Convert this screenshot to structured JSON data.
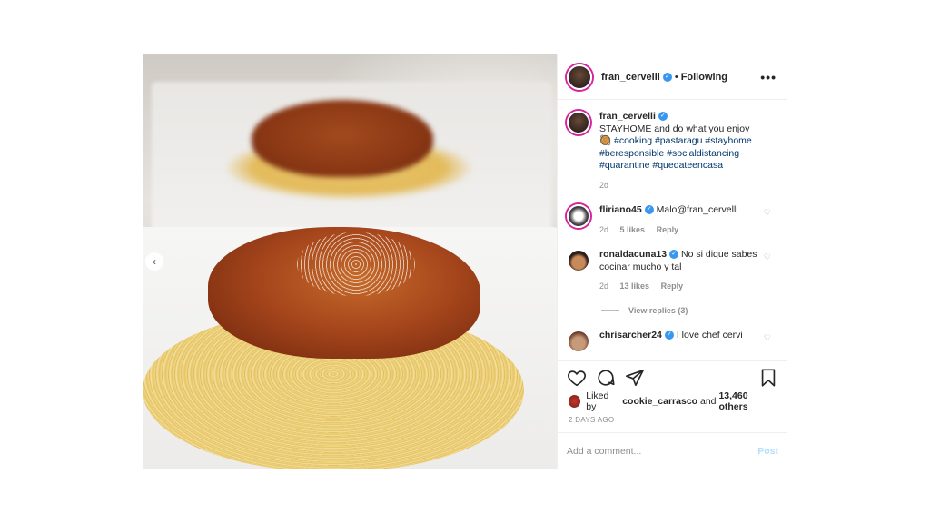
{
  "header": {
    "username": "fran_cervelli",
    "separator": "•",
    "follow_status": "Following",
    "more": "•••"
  },
  "caption": {
    "username": "fran_cervelli",
    "text": "STAYHOME and do what you enjoy",
    "emoji": "🥘",
    "hashtags_line1": "#cooking #pastaragu #stayhome",
    "hashtags_line2": "#beresponsible #socialdistancing",
    "hashtags_line3": "#quarantine #quedateencasa",
    "time": "2d"
  },
  "comments": [
    {
      "username": "fliriano45",
      "text": "Malo@fran_cervelli",
      "time": "2d",
      "likes": "5 likes",
      "reply": "Reply"
    },
    {
      "username": "ronaldacuna13",
      "text": "No si dique sabes cocinar mucho y tal",
      "time": "2d",
      "likes": "13 likes",
      "reply": "Reply",
      "view_replies": "View replies (3)"
    },
    {
      "username": "chrisarcher24",
      "text": "I love chef cervi"
    }
  ],
  "liked_by": {
    "prefix": "Liked by",
    "user": "cookie_carrasco",
    "conj": "and",
    "others": "13,460 others"
  },
  "post_date": "2 DAYS AGO",
  "add_comment": {
    "placeholder": "Add a comment...",
    "post_label": "Post"
  },
  "colors": {
    "link": "#00376b",
    "verified": "#3897f0",
    "post_disabled": "#b2dffc"
  },
  "icons": [
    "heart-icon",
    "comment-icon",
    "share-icon",
    "bookmark-icon",
    "chevron-left-icon",
    "verified-badge-icon"
  ]
}
